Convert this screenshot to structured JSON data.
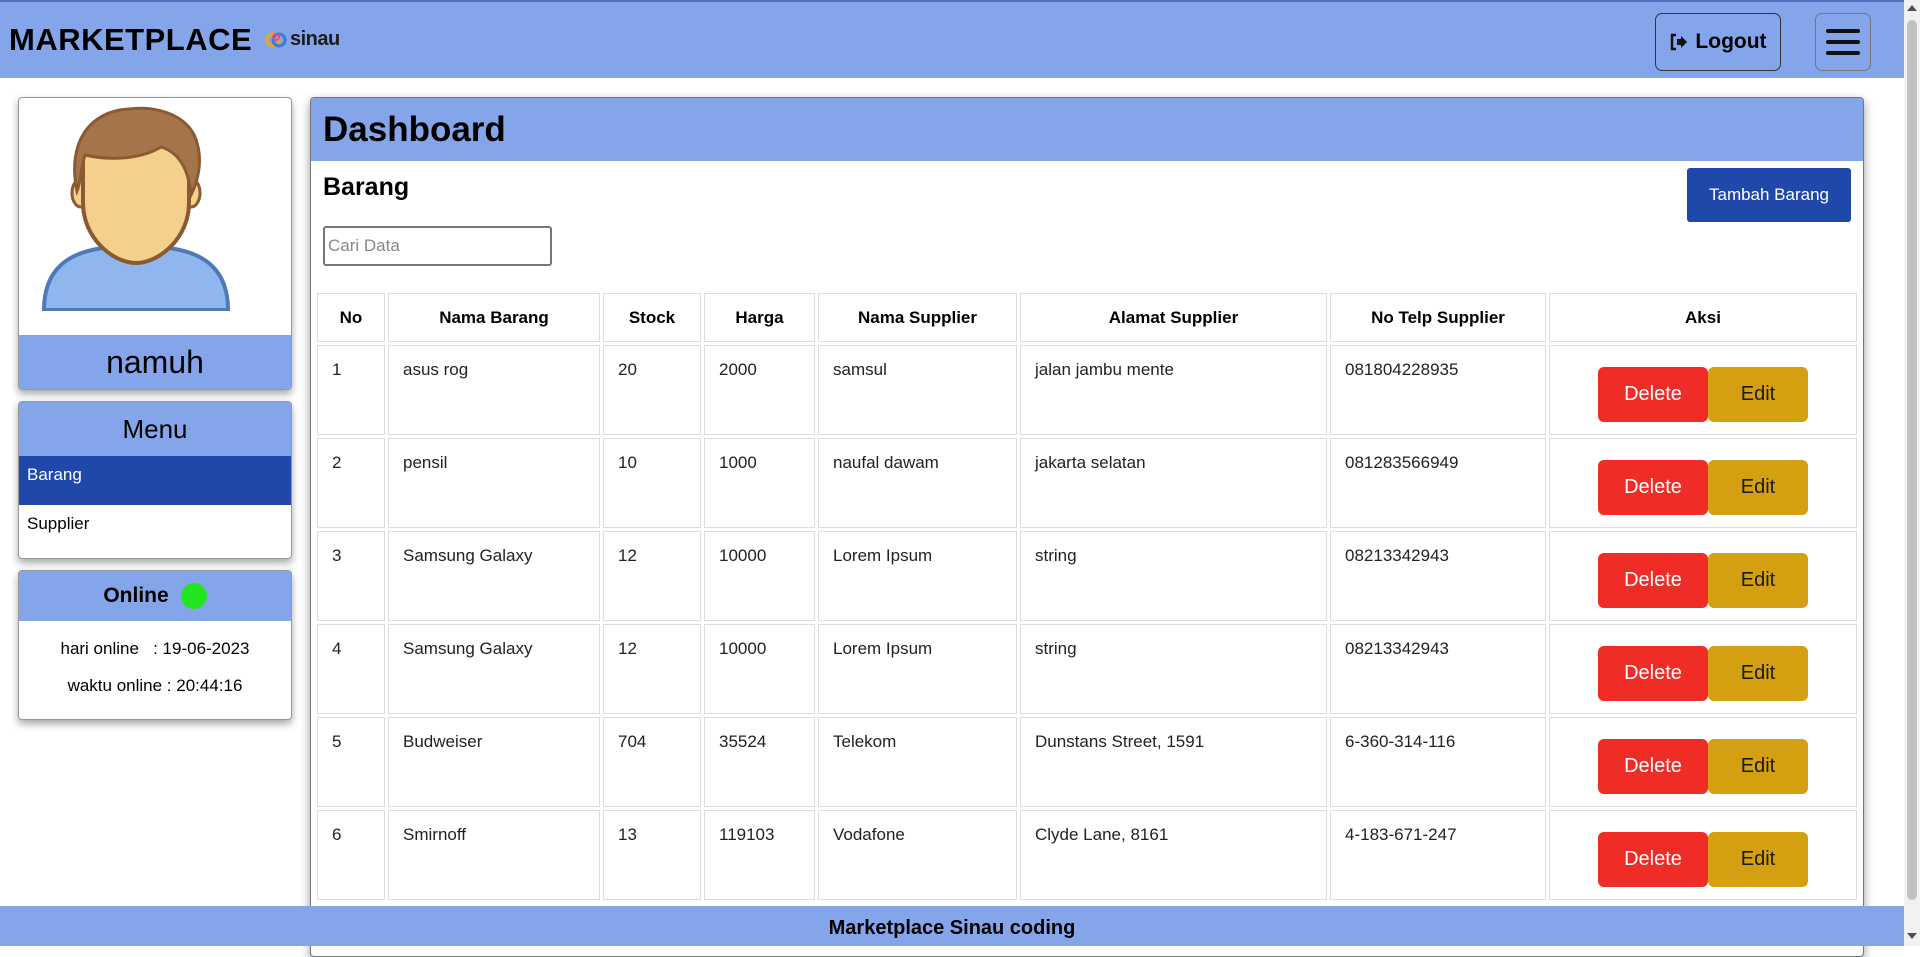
{
  "header": {
    "brand": "MARKETPLACE",
    "logo_text": "sinau",
    "logout_label": "Logout"
  },
  "profile": {
    "username": "namuh"
  },
  "menu": {
    "title": "Menu",
    "items": [
      {
        "label": "Barang"
      },
      {
        "label": "Supplier"
      }
    ]
  },
  "online": {
    "title": "Online",
    "hari_label": "hari online   : 19-06-2023",
    "waktu_label": "waktu online : 20:44:16"
  },
  "dashboard": {
    "title": "Dashboard",
    "section": "Barang",
    "add_button": "Tambah Barang",
    "search_placeholder": "Cari Data",
    "columns": [
      "No",
      "Nama Barang",
      "Stock",
      "Harga",
      "Nama Supplier",
      "Alamat Supplier",
      "No Telp Supplier",
      "Aksi"
    ],
    "rows": [
      {
        "no": "1",
        "nama": "asus rog",
        "stock": "20",
        "harga": "2000",
        "supplier": "samsul",
        "alamat": "jalan jambu mente",
        "telp": "081804228935"
      },
      {
        "no": "2",
        "nama": "pensil",
        "stock": "10",
        "harga": "1000",
        "supplier": "naufal dawam",
        "alamat": "jakarta selatan",
        "telp": "081283566949"
      },
      {
        "no": "3",
        "nama": "Samsung Galaxy",
        "stock": "12",
        "harga": "10000",
        "supplier": "Lorem Ipsum",
        "alamat": "string",
        "telp": "08213342943"
      },
      {
        "no": "4",
        "nama": "Samsung Galaxy",
        "stock": "12",
        "harga": "10000",
        "supplier": "Lorem Ipsum",
        "alamat": "string",
        "telp": "08213342943"
      },
      {
        "no": "5",
        "nama": "Budweiser",
        "stock": "704",
        "harga": "35524",
        "supplier": "Telekom",
        "alamat": "Dunstans Street, 1591",
        "telp": "6-360-314-116"
      },
      {
        "no": "6",
        "nama": "Smirnoff",
        "stock": "13",
        "harga": "119103",
        "supplier": "Vodafone",
        "alamat": "Clyde Lane, 8161",
        "telp": "4-183-671-247"
      }
    ],
    "delete_label": "Delete",
    "edit_label": "Edit"
  },
  "footer": {
    "text": "Marketplace Sinau coding"
  },
  "colors": {
    "primary_light": "#85a5ea",
    "primary_dark": "#1f48aa",
    "danger": "#ef2c25",
    "warning": "#d49f10",
    "online": "#22e51f"
  }
}
